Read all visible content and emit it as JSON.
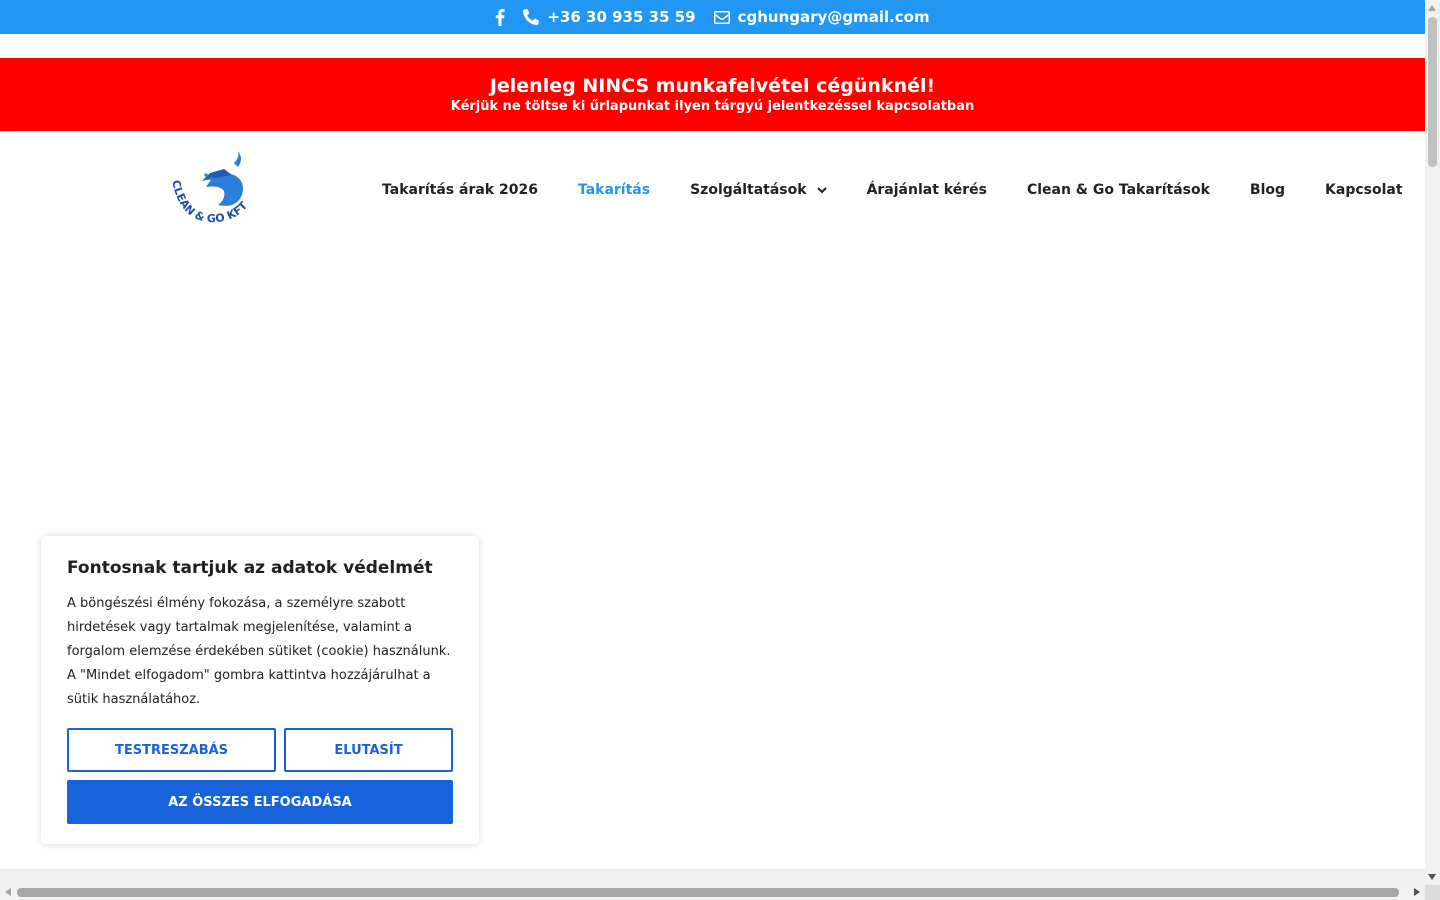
{
  "topbar": {
    "facebook_icon": "facebook-icon",
    "phone": "+36 30 935 35 59",
    "email": "cghungary@gmail.com",
    "background": "#2196f3"
  },
  "notice": {
    "title": "Jelenleg NINCS munkafelvétel cégünknél!",
    "subtitle": "Kérjük ne töltse ki űrlapunkat ilyen tárgyú jelentkezéssel kapcsolatban",
    "background": "#ff0000"
  },
  "header": {
    "logo_text_main": "CLEAN & GO",
    "logo_text_suffix": "KFT",
    "nav": [
      {
        "label": "Takarítás árak 2026",
        "active": false
      },
      {
        "label": "Takarítás",
        "active": true
      },
      {
        "label": "Szolgáltatások",
        "active": false,
        "dropdown": true
      },
      {
        "label": "Árajánlat kérés",
        "active": false
      },
      {
        "label": "Clean & Go Takarítások",
        "active": false
      },
      {
        "label": "Blog",
        "active": false
      },
      {
        "label": "Kapcsolat",
        "active": false
      }
    ],
    "accent": "#2196f3"
  },
  "cookie": {
    "title": "Fontosnak tartjuk az adatok védelmét",
    "text": "A böngészési élmény fokozása, a személyre szabott hirdetések vagy tartalmak megjelenítése, valamint a forgalom elemzése érdekében sütiket (cookie) használunk. A \"Mindet elfogadom\" gombra kattintva hozzájárulhat a sütik használatához.",
    "customize_label": "TESTRESZABÁS",
    "reject_label": "ELUTASÍT",
    "accept_all_label": "AZ ÖSSZES ELFOGADÁSA",
    "button_color": "#1863dc"
  }
}
